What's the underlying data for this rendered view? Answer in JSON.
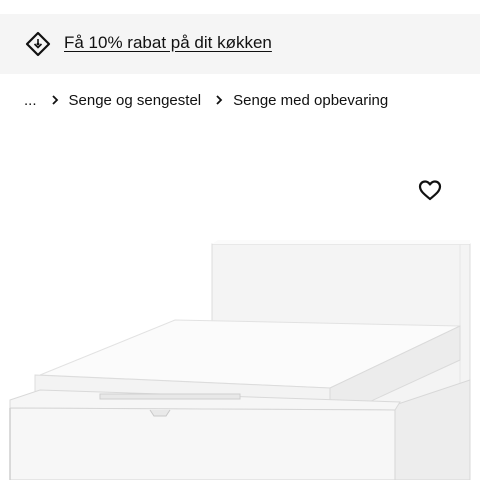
{
  "promo": {
    "icon": "price-tag-icon",
    "text": "Få 10% rabat på dit køkken"
  },
  "breadcrumb": {
    "items": [
      "...",
      "Senge og sengestel",
      "Senge med opbevaring"
    ],
    "separator_icon": "chevron-right-icon"
  },
  "product": {
    "favourite_icon": "heart-icon",
    "image": "white-bed-with-storage-image"
  },
  "colors": {
    "promo_background": "#f5f5f5",
    "text": "#111111"
  }
}
